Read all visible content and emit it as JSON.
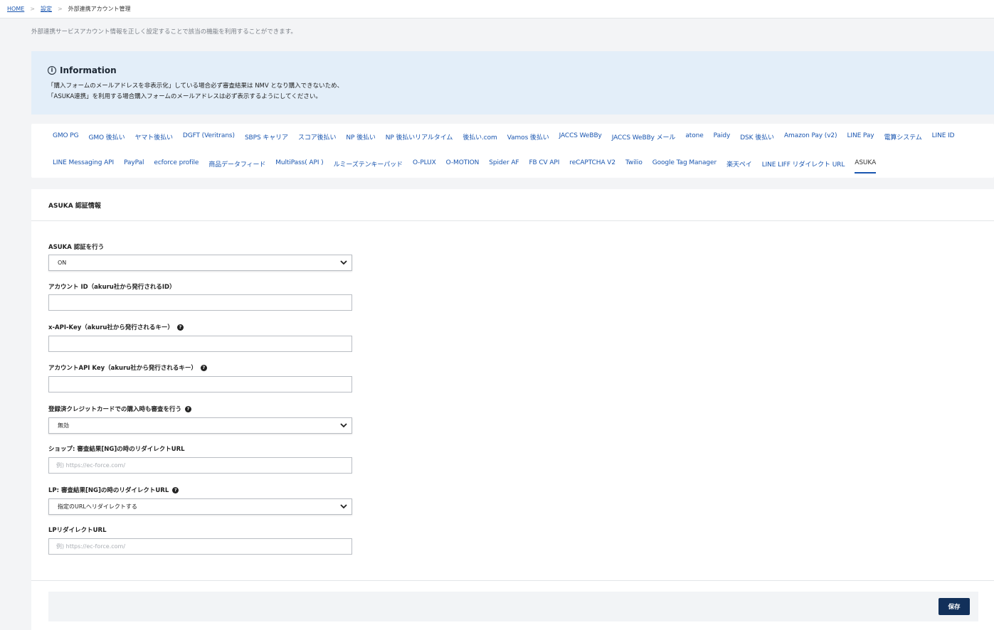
{
  "breadcrumb": {
    "home": "HOME",
    "settings": "設定",
    "current": "外部連携アカウント管理",
    "separator": ">"
  },
  "page": {
    "description": "外部連携サービスアカウント情報を正しく設定することで該当の機能を利用することができます。"
  },
  "info": {
    "title": "Information",
    "icon": "info-icon",
    "line1": "「購入フォームのメールアドレスを非表示化」している場合必ず審査結果は NMV となり購入できないため、",
    "line2": "「ASUKA連携」を利用する場合購入フォームのメールアドレスは必ず表示するようにしてください。"
  },
  "tabs": {
    "row1": [
      "GMO PG",
      "GMO 後払い",
      "ヤマト後払い",
      "DGFT (Veritrans)",
      "SBPS キャリア",
      "スコア後払い",
      "NP 後払い",
      "NP 後払いリアルタイム",
      "後払い.com",
      "Vamos 後払い",
      "JACCS WeBBy",
      "JACCS WeBBy メール",
      "atone",
      "Paidy",
      "DSK 後払い",
      "Amazon Pay (v2)",
      "LINE Pay",
      "電算システム",
      "LINE ID"
    ],
    "row2": [
      "LINE Messaging API",
      "PayPal",
      "ecforce profile",
      "商品データフィード",
      "MultiPass( API )",
      "ルミーズテンキーパッド",
      "O-PLUX",
      "O-MOTION",
      "Spider AF",
      "FB CV API",
      "reCAPTCHA V2",
      "Twilio",
      "Google Tag Manager",
      "楽天ペイ",
      "LINE LIFF リダイレクト URL",
      "ASUKA"
    ],
    "active": "ASUKA"
  },
  "form": {
    "section_title": "ASUKA 認証情報",
    "fields": {
      "asuka_auth": {
        "label": "ASUKA 認証を行う",
        "value": "ON"
      },
      "account_id": {
        "label": "アカウント ID（akuru社から発行されるID）",
        "value": ""
      },
      "x_api_key": {
        "label": "x-API-Key（akuru社から発行されるキー）",
        "value": ""
      },
      "account_api_key": {
        "label": "アカウントAPI Key（akuru社から発行されるキー）",
        "value": ""
      },
      "registered_card": {
        "label": "登録済クレジットカードでの購入時も審査を行う",
        "value": "無効"
      },
      "shop_redirect_url": {
        "label": "ショップ: 審査結果[NG]の時のリダイレクトURL",
        "placeholder": "例) https://ec-force.com/"
      },
      "lp_redirect_mode": {
        "label": "LP: 審査結果[NG]の時のリダイレクトURL",
        "value": "指定のURLへリダイレクトする"
      },
      "lp_redirect_url": {
        "label": "LPリダイレクトURL",
        "placeholder": "例) https://ec-force.com/"
      }
    },
    "save_label": "保存"
  },
  "colors": {
    "link": "#1a56b0",
    "info_bg": "#e3eef9",
    "save_button": "#12305a",
    "page_bg": "#f3f4f6"
  }
}
